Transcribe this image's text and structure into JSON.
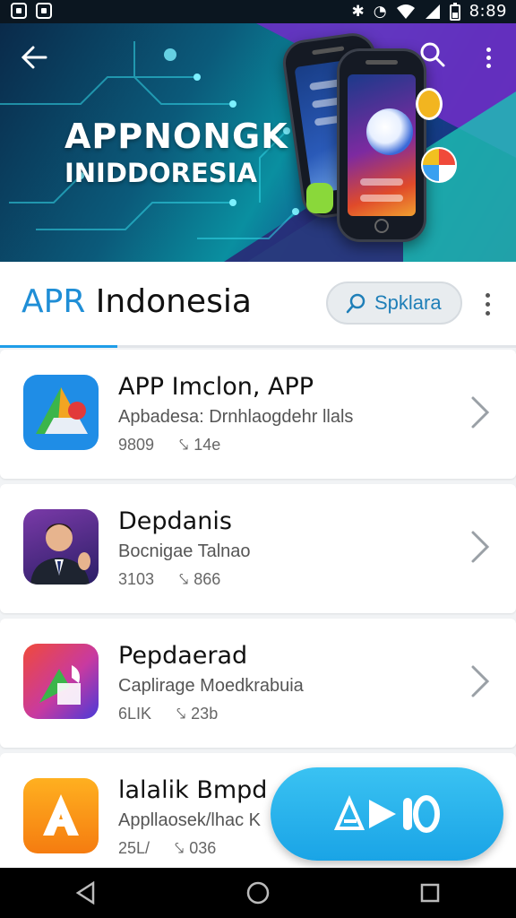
{
  "status_bar": {
    "time": "8:89",
    "icons": [
      "notification-icon",
      "image-icon",
      "bluetooth-icon",
      "alarm-icon",
      "wifi-icon",
      "signal-icon",
      "battery-icon"
    ]
  },
  "banner": {
    "title": "APPNONGK",
    "subtitle": "INIDDORESIA",
    "icons": [
      "back-arrow-icon",
      "search-icon",
      "more-vert-icon"
    ]
  },
  "header": {
    "title_accent": "APR",
    "title_rest": " Indonesia",
    "search_label": "Spklara",
    "accent_color": "#1f9de8"
  },
  "apps": [
    {
      "name": "APP Imclon, APP",
      "description": "Apbadesa: Drnhlaogdehr llals",
      "rating": "9809",
      "downloads": "14e",
      "icon": "triangle-logo-icon"
    },
    {
      "name": "Depdanis",
      "description": "Bocnigae Talnao",
      "rating": "3103",
      "downloads": "866",
      "icon": "person-avatar-icon"
    },
    {
      "name": "Pepdaerad",
      "description": "Caplirage Moedkrabuia",
      "rating": "6LIK",
      "downloads": "23b",
      "icon": "shape-logo-icon"
    },
    {
      "name": "lalalik Bmpd",
      "description": "Appllaosek/lhac K",
      "rating": "25L/",
      "downloads": "036",
      "icon": "letter-a-icon"
    }
  ],
  "fab": {
    "icon": "play-logo-icon"
  },
  "nav": [
    "back-nav-icon",
    "home-nav-icon",
    "recents-nav-icon"
  ]
}
